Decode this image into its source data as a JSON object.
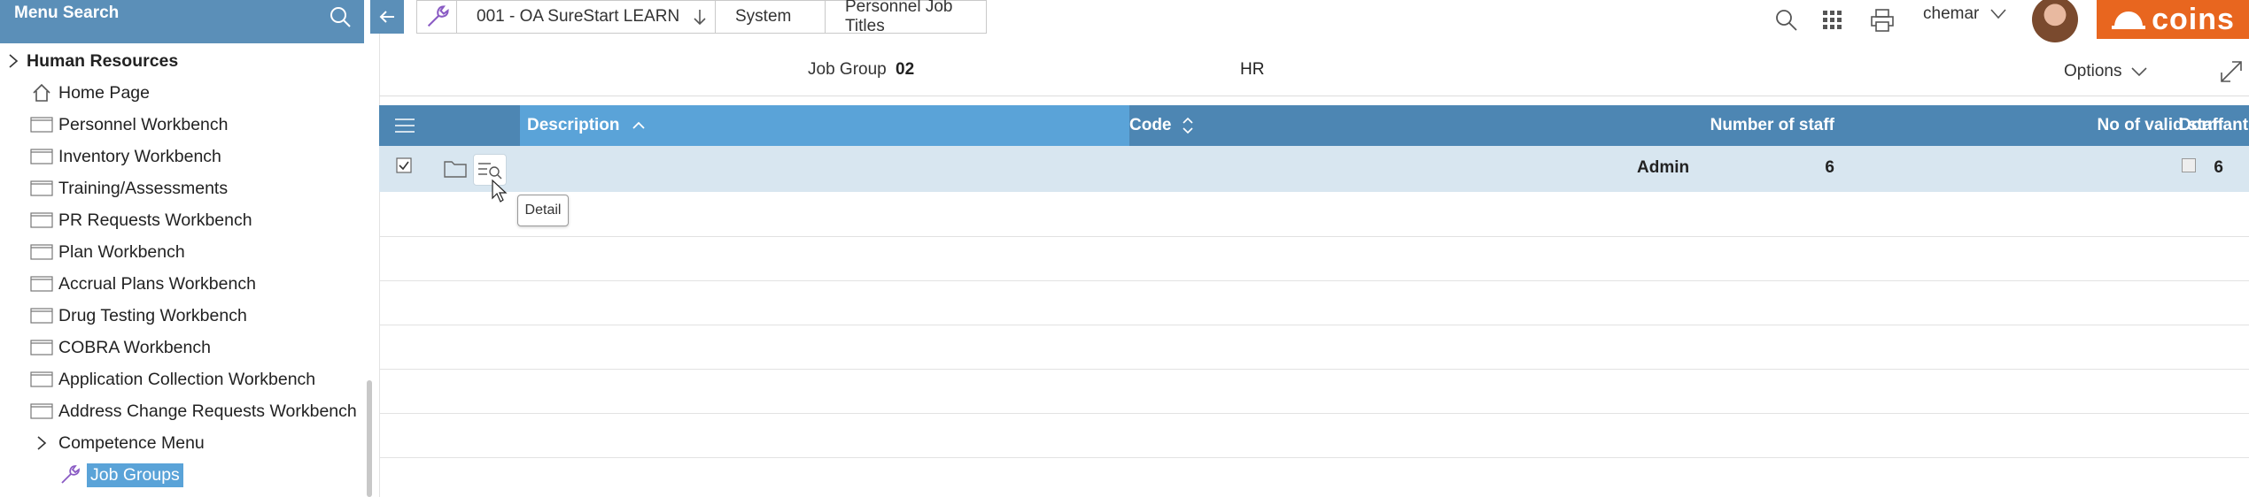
{
  "sidebar": {
    "search_label": "Menu Search",
    "section": "Human Resources",
    "items": [
      {
        "label": "Home Page",
        "icon": "home-icon"
      },
      {
        "label": "Personnel Workbench",
        "icon": "window-icon"
      },
      {
        "label": "Inventory Workbench",
        "icon": "window-icon"
      },
      {
        "label": "Training/Assessments",
        "icon": "window-icon"
      },
      {
        "label": "PR Requests Workbench",
        "icon": "window-icon"
      },
      {
        "label": "Plan Workbench",
        "icon": "window-icon"
      },
      {
        "label": "Accrual Plans Workbench",
        "icon": "window-icon"
      },
      {
        "label": "Drug Testing Workbench",
        "icon": "window-icon"
      },
      {
        "label": "COBRA Workbench",
        "icon": "window-icon"
      },
      {
        "label": "Application Collection Workbench",
        "icon": "window-icon"
      },
      {
        "label": "Address Change Requests Workbench",
        "icon": "window-icon"
      },
      {
        "label": "Competence Menu",
        "icon": "chevron-right-icon"
      },
      {
        "label": "Job Groups",
        "icon": "wrench-icon",
        "selected": true
      }
    ]
  },
  "breadcrumb": {
    "company": "001 - OA SureStart LEARN",
    "system": "System",
    "page": "Personnel Job Titles"
  },
  "header": {
    "user": "chemar",
    "logo_text": "coins"
  },
  "info": {
    "job_group_label": "Job Group",
    "job_group_value": "02",
    "job_group_desc": "HR",
    "options_label": "Options"
  },
  "grid": {
    "columns": {
      "description": "Description",
      "code": "Code",
      "number_of_staff": "Number of staff",
      "no_valid_staff": "No of valid staff",
      "dormant": "Dormant"
    },
    "rows": [
      {
        "description": "",
        "code": "Admin",
        "number_of_staff": "6",
        "no_valid_staff": "6",
        "dormant": false,
        "selected": true
      }
    ],
    "tooltip": "Detail"
  },
  "colors": {
    "accent": "#5b8fb8",
    "header": "#4d86b3",
    "sorted_header": "#5aa3d8",
    "row_highlight": "#d8e6f0",
    "brand": "#e8661f"
  }
}
